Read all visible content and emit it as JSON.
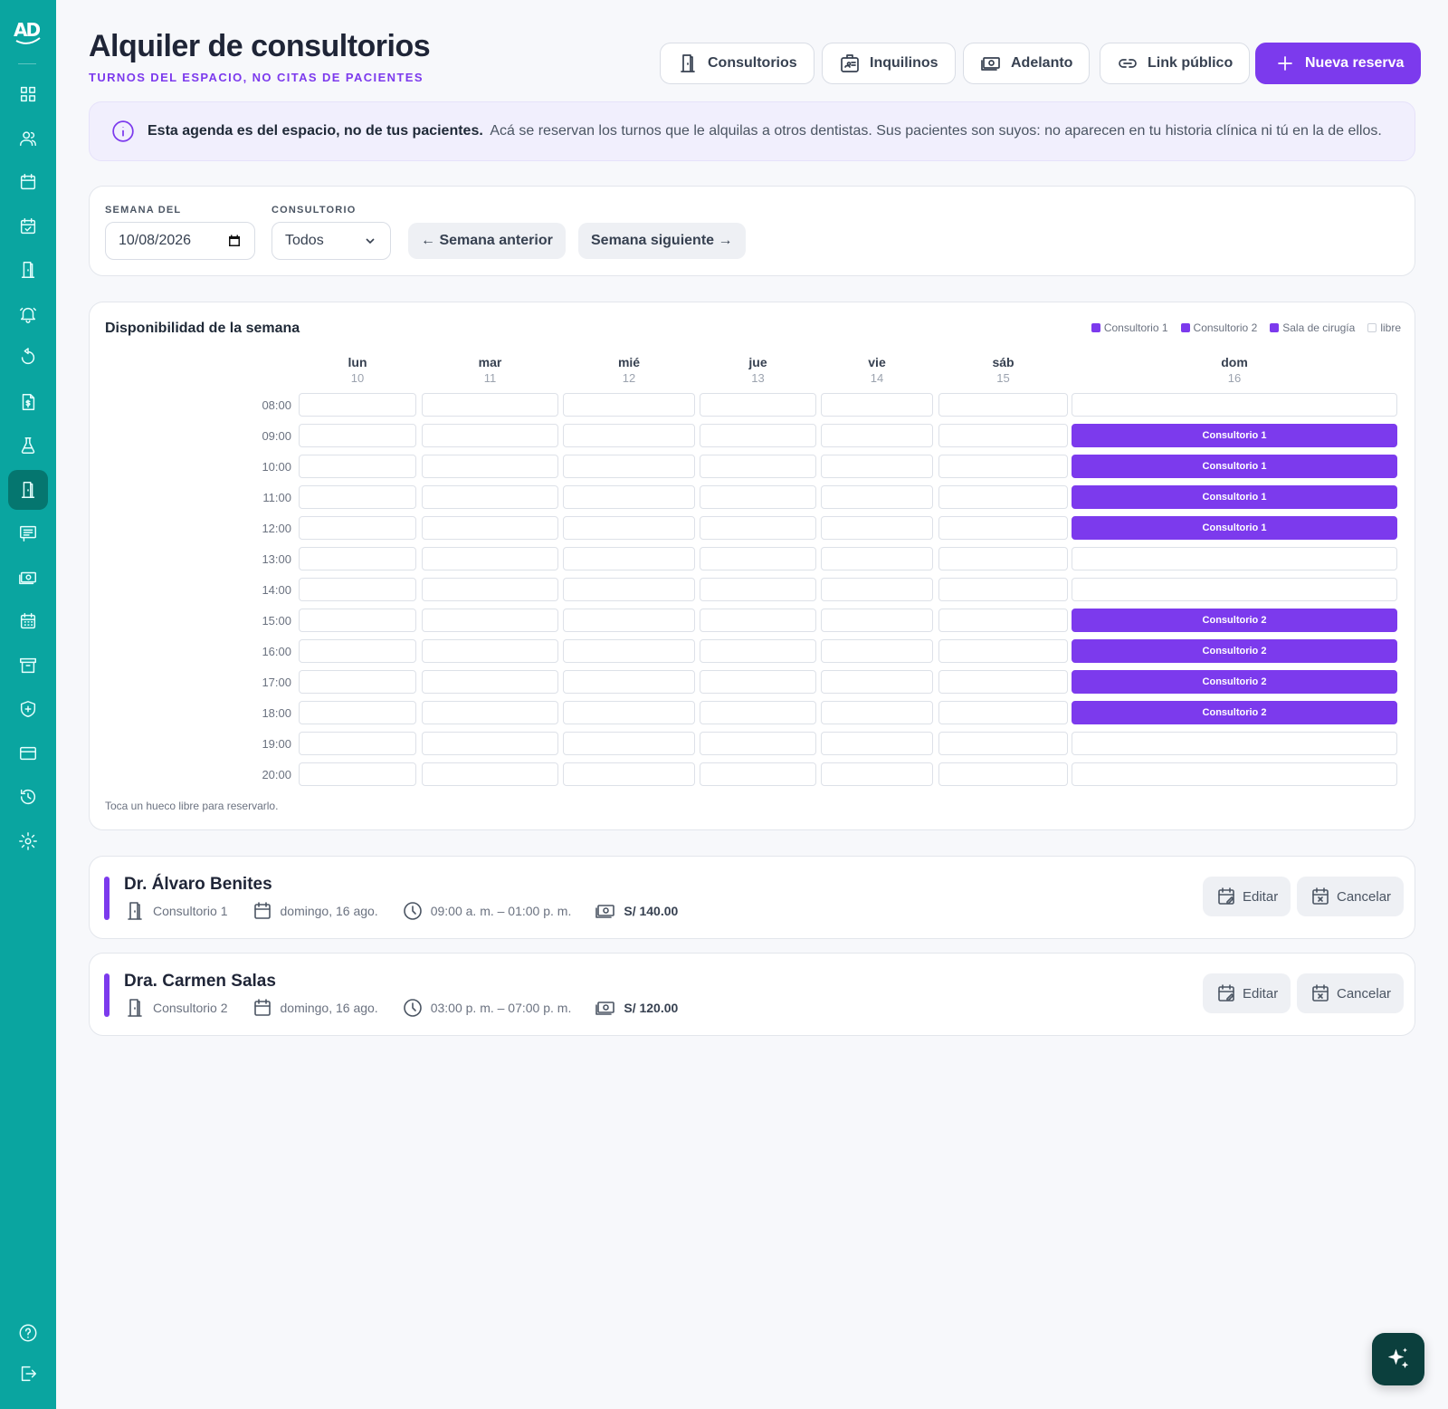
{
  "app": {
    "logo_text": "AD"
  },
  "sidebar": {
    "items": [
      {
        "icon": "dashboard-icon"
      },
      {
        "icon": "patients-icon"
      },
      {
        "icon": "calendar-icon"
      },
      {
        "icon": "calendar-check-icon"
      },
      {
        "icon": "door-icon"
      },
      {
        "icon": "bell-icon"
      },
      {
        "icon": "refresh-icon"
      },
      {
        "icon": "invoice-icon"
      },
      {
        "icon": "lab-flask-icon"
      },
      {
        "icon": "door-icon",
        "active": true
      },
      {
        "icon": "message-icon"
      },
      {
        "icon": "money-icon"
      },
      {
        "icon": "calendar-grid-icon"
      },
      {
        "icon": "archive-icon"
      },
      {
        "icon": "shield-icon"
      },
      {
        "icon": "credit-card-icon"
      },
      {
        "icon": "history-icon"
      },
      {
        "icon": "gear-icon"
      }
    ],
    "footer": [
      {
        "icon": "help-icon"
      },
      {
        "icon": "logout-icon"
      }
    ]
  },
  "header": {
    "title": "Alquiler de consultorios",
    "subtitle": "TURNOS DEL ESPACIO, NO CITAS DE PACIENTES",
    "buttons": {
      "consultorios": "Consultorios",
      "inquilinos": "Inquilinos",
      "adelanto": "Adelanto",
      "link_publico": "Link público",
      "nueva_reserva": "Nueva reserva"
    }
  },
  "info": {
    "bold": "Esta agenda es del espacio, no de tus pacientes.",
    "text": "Acá se reservan los turnos que le alquilas a otros dentistas. Sus pacientes son suyos: no aparecen en tu historia clínica ni tú en la de ellos."
  },
  "filters": {
    "week_label": "SEMANA DEL",
    "week_value": "10/08/2026",
    "room_label": "CONSULTORIO",
    "room_value": "Todos",
    "prev": "← Semana anterior",
    "next": "Semana siguiente →"
  },
  "calendar": {
    "title": "Disponibilidad de la semana",
    "legend": [
      {
        "label": "Consultorio 1",
        "color": "#7c3aed"
      },
      {
        "label": "Consultorio 2",
        "color": "#7c3aed"
      },
      {
        "label": "Sala de cirugía",
        "color": "#7c3aed"
      },
      {
        "label": "libre",
        "color": "#ffffff"
      }
    ],
    "days": [
      {
        "name": "lun",
        "num": "10"
      },
      {
        "name": "mar",
        "num": "11"
      },
      {
        "name": "mié",
        "num": "12"
      },
      {
        "name": "jue",
        "num": "13"
      },
      {
        "name": "vie",
        "num": "14"
      },
      {
        "name": "sáb",
        "num": "15"
      },
      {
        "name": "dom",
        "num": "16"
      }
    ],
    "hours": [
      "08:00",
      "09:00",
      "10:00",
      "11:00",
      "12:00",
      "13:00",
      "14:00",
      "15:00",
      "16:00",
      "17:00",
      "18:00",
      "19:00",
      "20:00"
    ],
    "bookings": [
      {
        "day": 6,
        "hour": "09:00",
        "label": "Consultorio 1"
      },
      {
        "day": 6,
        "hour": "10:00",
        "label": "Consultorio 1"
      },
      {
        "day": 6,
        "hour": "11:00",
        "label": "Consultorio 1"
      },
      {
        "day": 6,
        "hour": "12:00",
        "label": "Consultorio 1"
      },
      {
        "day": 6,
        "hour": "15:00",
        "label": "Consultorio 2"
      },
      {
        "day": 6,
        "hour": "16:00",
        "label": "Consultorio 2"
      },
      {
        "day": 6,
        "hour": "17:00",
        "label": "Consultorio 2"
      },
      {
        "day": 6,
        "hour": "18:00",
        "label": "Consultorio 2"
      }
    ],
    "hint": "Toca un hueco libre para reservarlo."
  },
  "reservations": [
    {
      "name": "Dr. Álvaro Benites",
      "room": "Consultorio 1",
      "date": "domingo, 16 ago.",
      "time": "09:00 a. m. – 01:00 p. m.",
      "amount": "S/ 140.00",
      "edit": "Editar",
      "cancel": "Cancelar"
    },
    {
      "name": "Dra. Carmen Salas",
      "room": "Consultorio 2",
      "date": "domingo, 16 ago.",
      "time": "03:00 p. m. – 07:00 p. m.",
      "amount": "S/ 120.00",
      "edit": "Editar",
      "cancel": "Cancelar"
    }
  ],
  "colors": {
    "sidebar": "#0aa5a0",
    "accent": "#7c3aed",
    "fab": "#0b3f3d"
  }
}
